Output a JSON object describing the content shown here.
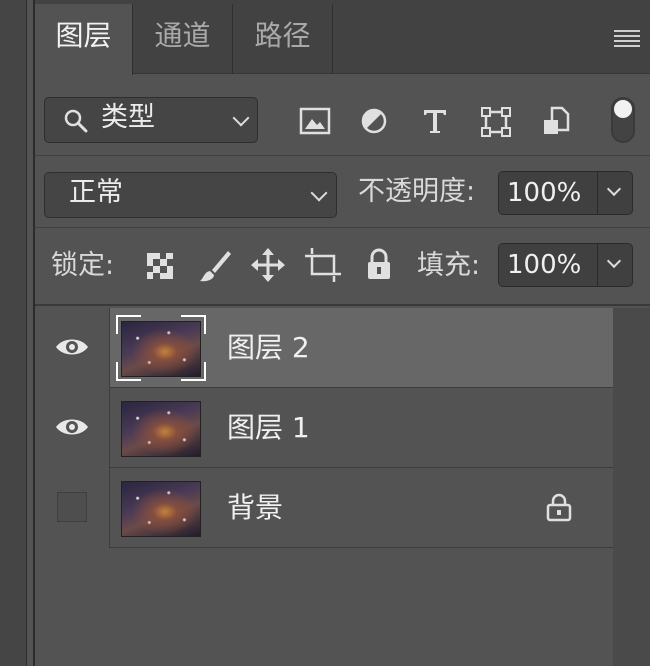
{
  "tabs": [
    {
      "label": "图层",
      "active": true
    },
    {
      "label": "通道",
      "active": false
    },
    {
      "label": "路径",
      "active": false
    }
  ],
  "filter": {
    "kind_label": "类型",
    "icons": [
      "image-filter-icon",
      "adjustment-filter-icon",
      "text-filter-icon",
      "shape-filter-icon",
      "smart-object-filter-icon"
    ]
  },
  "blend": {
    "mode": "正常",
    "opacity_label": "不透明度:",
    "opacity_value": "100%"
  },
  "lock": {
    "label": "锁定:",
    "fill_label": "填充:",
    "fill_value": "100%"
  },
  "layers": [
    {
      "name": "图层 2",
      "visible": true,
      "selected": true,
      "locked": false
    },
    {
      "name": "图层 1",
      "visible": true,
      "selected": false,
      "locked": false
    },
    {
      "name": "背景",
      "visible": false,
      "selected": false,
      "locked": true
    }
  ],
  "colors": {
    "panel_bg": "#535353",
    "selected_row": "#676767",
    "tab_bar": "#424242"
  }
}
